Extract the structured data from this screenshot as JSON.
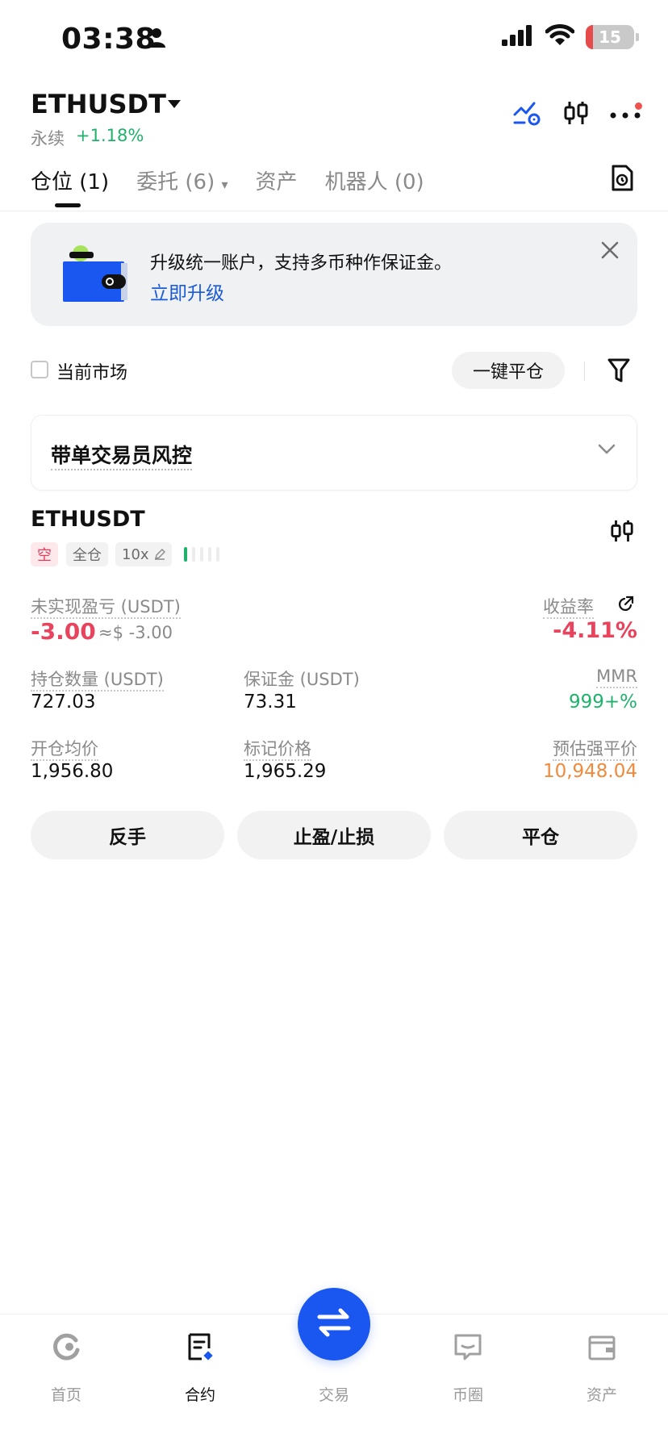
{
  "status_bar": {
    "time": "03:38",
    "battery": "15",
    "battery_level": 0.15
  },
  "header": {
    "symbol": "ETHUSDT",
    "contract_type": "永续",
    "change": "+1.18%"
  },
  "tabs": [
    {
      "label": "仓位",
      "count": "(1)"
    },
    {
      "label": "委托",
      "count": "(6)"
    },
    {
      "label": "资产",
      "count": ""
    },
    {
      "label": "机器人",
      "count": "(0)"
    }
  ],
  "banner": {
    "text": "升级统一账户，支持多币种作保证金。",
    "link": "立即升级"
  },
  "filters": {
    "current_market": "当前市场",
    "close_all": "一键平仓"
  },
  "risk_card": {
    "title": "带单交易员风控"
  },
  "position": {
    "symbol": "ETHUSDT",
    "side": "空",
    "margin_mode": "全仓",
    "leverage": "10x",
    "risk_level": 0.2,
    "unrealized_pnl_label": "未实现盈亏 (USDT)",
    "unrealized_pnl": "-3.00",
    "unrealized_pnl_usd": "≈$ -3.00",
    "roi_label": "收益率",
    "roi": "-4.11%",
    "qty_label": "持仓数量 (USDT)",
    "qty": "727.03",
    "margin_label": "保证金 (USDT)",
    "margin": "73.31",
    "mmr_label": "MMR",
    "mmr": "999+%",
    "entry_label": "开仓均价",
    "entry": "1,956.80",
    "mark_label": "标记价格",
    "mark": "1,965.29",
    "liq_label": "预估强平价",
    "liq": "10,948.04"
  },
  "actions": {
    "reverse": "反手",
    "tpsl": "止盈/止损",
    "close": "平仓"
  },
  "bottom_nav": [
    {
      "label": "首页",
      "icon": "home-icon"
    },
    {
      "label": "合约",
      "icon": "futures-icon"
    },
    {
      "label": "交易",
      "icon": "swap-icon"
    },
    {
      "label": "币圈",
      "icon": "chat-icon"
    },
    {
      "label": "资产",
      "icon": "wallet-icon"
    }
  ],
  "colors": {
    "accent": "#1a56f0",
    "up": "#20b26c",
    "down": "#e8445e",
    "liq": "#f08a3c"
  }
}
